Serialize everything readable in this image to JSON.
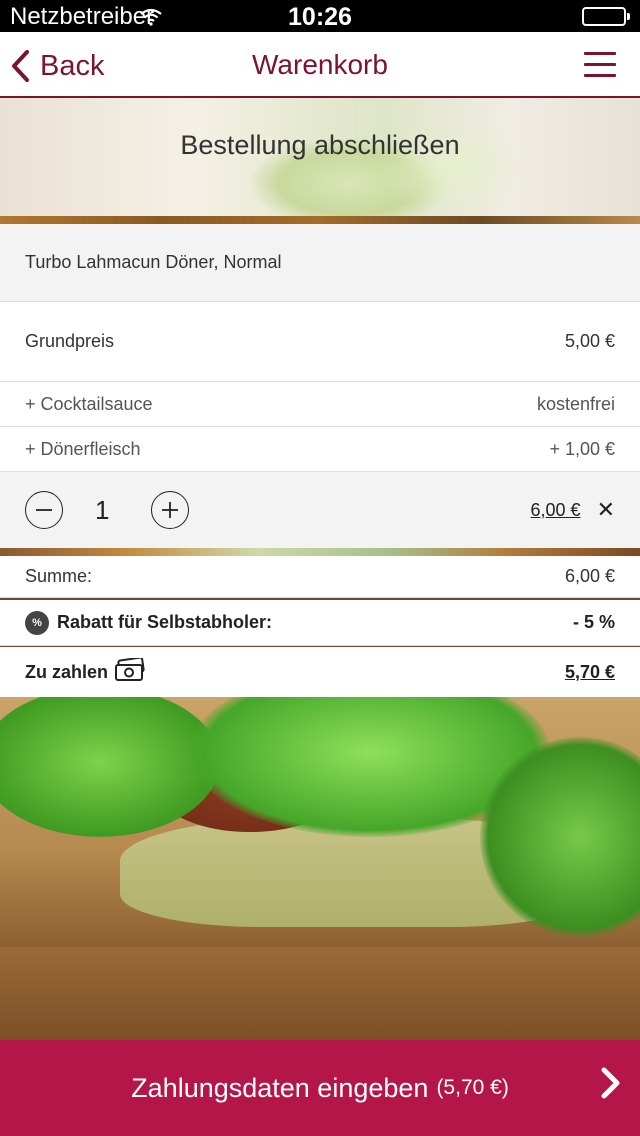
{
  "status": {
    "carrier": "Netzbetreiber",
    "time": "10:26",
    "battery_level": 1.0
  },
  "nav": {
    "back_label": "Back",
    "title": "Warenkorb",
    "menu_icon": "hamburger-icon"
  },
  "hero": {
    "heading": "Bestellung abschließen"
  },
  "order": {
    "item_name": "Turbo Lahmacun Döner, Normal",
    "base_price_label": "Grundpreis",
    "base_price": "5,00 €",
    "extras": [
      {
        "label": "+ Cocktailsauce",
        "price": "kostenfrei"
      },
      {
        "label": "+ Dönerfleisch",
        "price": "+ 1,00 €"
      }
    ],
    "quantity": "1",
    "line_total": "6,00 €",
    "remove_symbol": "✕"
  },
  "summary": {
    "sum_label": "Summe:",
    "sum_value": "6,00 €",
    "discount_badge": "%",
    "discount_label": "Rabatt für Selbstabholer:",
    "discount_value": "- 5 %",
    "pay_label": "Zu zahlen",
    "pay_value": "5,70 €"
  },
  "cta": {
    "label": "Zahlungsdaten eingeben",
    "price": "(5,70 €)"
  },
  "colors": {
    "brand": "#7a1430",
    "cta": "#b5164a"
  }
}
